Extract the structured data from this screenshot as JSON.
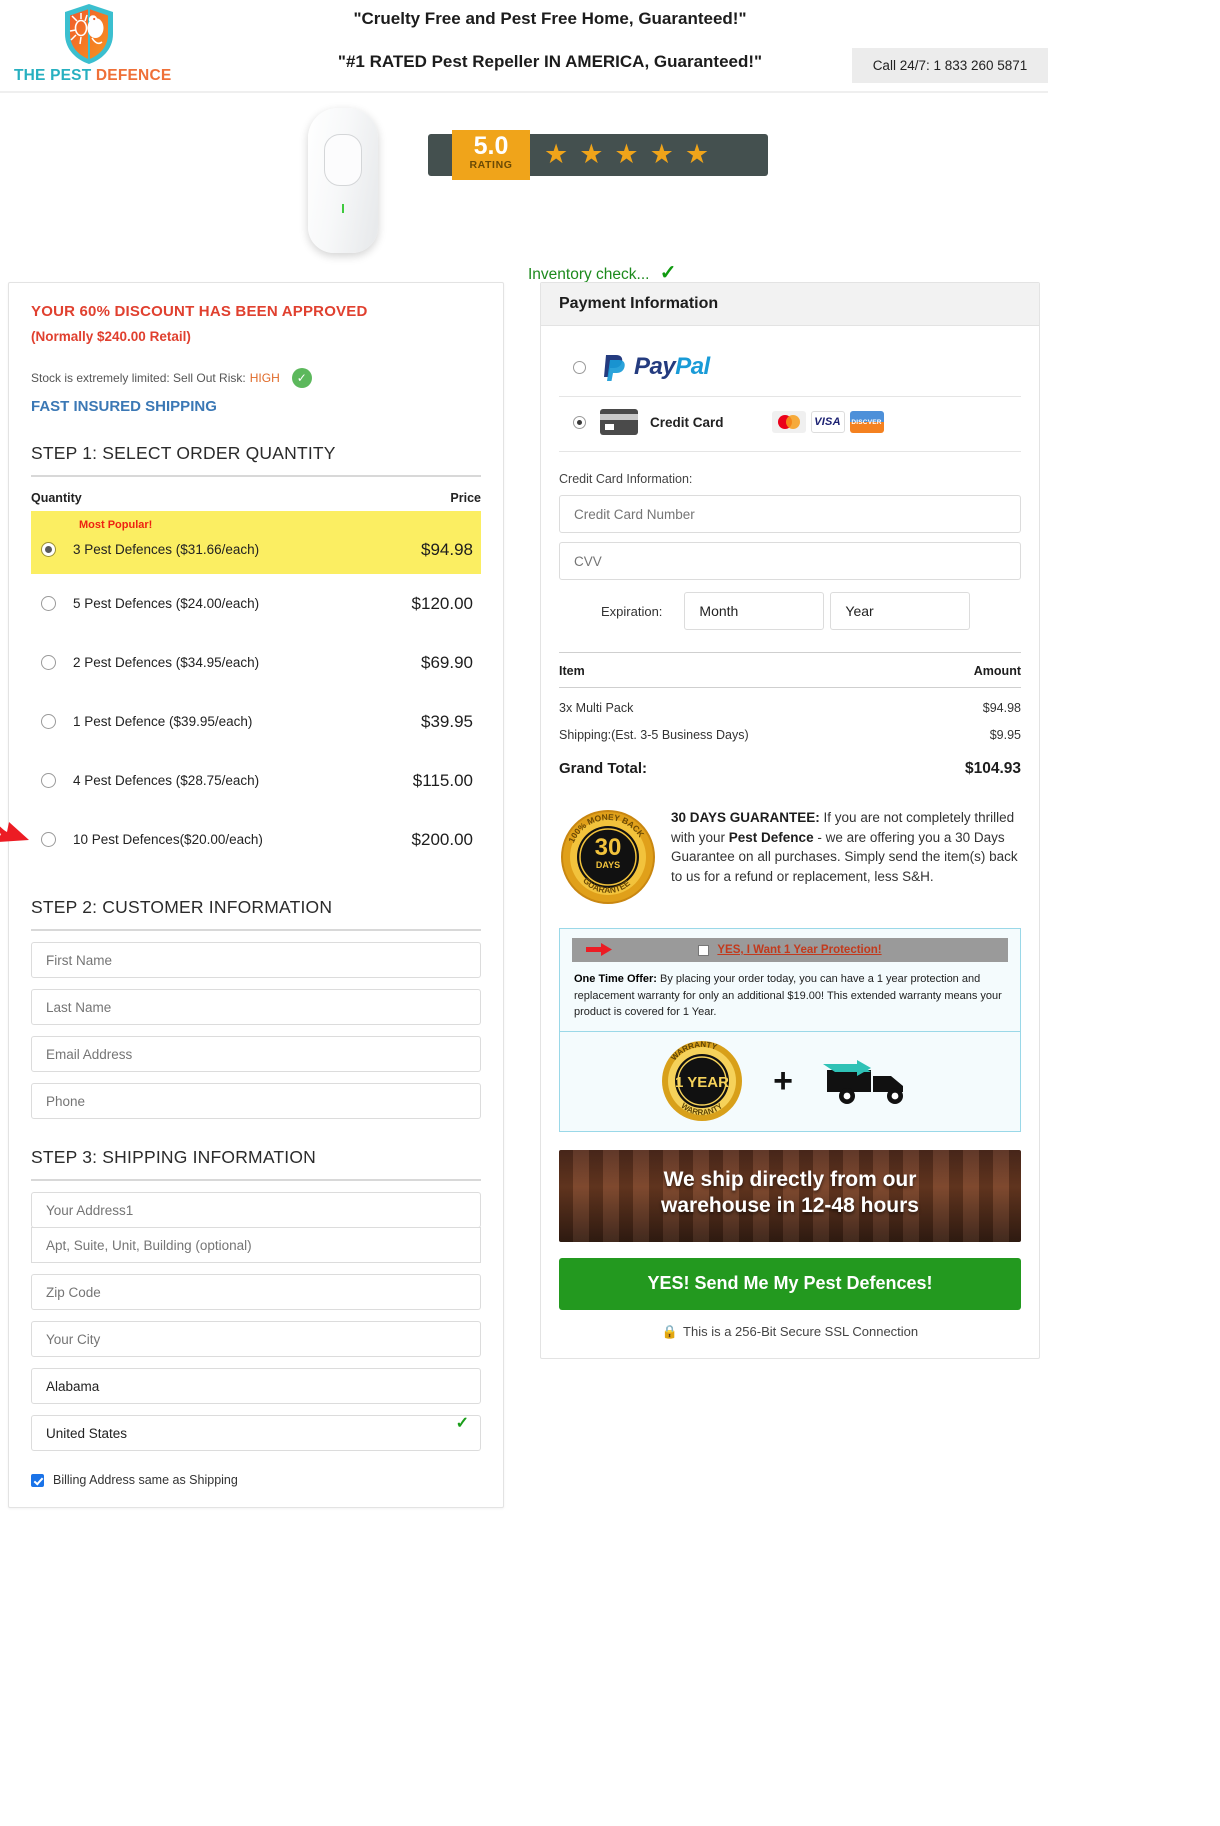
{
  "header": {
    "logo": {
      "part1": "THE PEST",
      "part2": "DEFENCE",
      "icon": "shield-bug-icon"
    },
    "headline1": "\"Cruelty Free and Pest Free Home, Guaranteed!\"",
    "headline2": "\"#1 RATED Pest Repeller IN AMERICA, Guaranteed!\"",
    "call": "Call 24/7: 1 833 260 5871"
  },
  "hero": {
    "rating_value": "5.0",
    "rating_label": "RATING",
    "stars": "★★★★★",
    "inventory_text": "Inventory check...",
    "inventory_check": "✓"
  },
  "left": {
    "discount_headline": "YOUR 60% DISCOUNT HAS BEEN APPROVED",
    "retail_note": "(Normally $240.00 Retail)",
    "stock_text": "Stock is extremely limited: Sell Out Risk:",
    "stock_risk": "HIGH",
    "stock_check": "✓",
    "fast_shipping": "FAST INSURED SHIPPING",
    "step1_title": "STEP 1: SELECT ORDER QUANTITY",
    "col_quantity": "Quantity",
    "col_price": "Price",
    "most_popular": "Most Popular!",
    "options": [
      {
        "label": "3 Pest Defences ($31.66/each)",
        "price": "$94.98",
        "selected": true,
        "popular": true
      },
      {
        "label": "5 Pest Defences ($24.00/each)",
        "price": "$120.00",
        "selected": false,
        "popular": false
      },
      {
        "label": "2 Pest Defences ($34.95/each)",
        "price": "$69.90",
        "selected": false,
        "popular": false
      },
      {
        "label": "1 Pest Defence ($39.95/each)",
        "price": "$39.95",
        "selected": false,
        "popular": false
      },
      {
        "label": "4 Pest Defences ($28.75/each)",
        "price": "$115.00",
        "selected": false,
        "popular": false
      },
      {
        "label": "10 Pest Defences($20.00/each)",
        "price": "$200.00",
        "selected": false,
        "popular": false
      }
    ],
    "step2_title": "STEP 2: CUSTOMER INFORMATION",
    "first_name_placeholder": "First Name",
    "last_name_placeholder": "Last Name",
    "email_placeholder": "Email Address",
    "phone_placeholder": "Phone",
    "step3_title": "STEP 3: SHIPPING INFORMATION",
    "address1_placeholder": "Your Address1",
    "address2_placeholder": "Apt, Suite, Unit, Building (optional)",
    "zip_placeholder": "Zip Code",
    "city_placeholder": "Your City",
    "state_value": "Alabama",
    "country_value": "United States",
    "country_check": "✓",
    "billing_same": "Billing Address same as Shipping"
  },
  "payment": {
    "title": "Payment Information",
    "paypal_label": "PayPal",
    "credit_card_label": "Credit Card",
    "card_brands": [
      "mastercard",
      "visa",
      "discover"
    ],
    "cc_info_label": "Credit Card Information:",
    "cc_number_placeholder": "Credit Card Number",
    "cvv_placeholder": "CVV",
    "expiration_label": "Expiration:",
    "month_value": "Month",
    "year_value": "Year",
    "summary": {
      "col_item": "Item",
      "col_amount": "Amount",
      "rows": [
        {
          "item": "3x Multi Pack",
          "amount": "$94.98"
        },
        {
          "item": "Shipping:(Est. 3-5 Business Days)",
          "amount": "$9.95"
        }
      ],
      "grand_total_label": "Grand Total:",
      "grand_total_amount": "$104.93"
    },
    "guarantee": {
      "seal_line1": "100% MONEY BACK",
      "seal_days": "30",
      "seal_sub": "DAYS",
      "seal_bottom": "GUARANTEE",
      "heading": "30 DAYS GUARANTEE:",
      "body": " If you are not completely thrilled with your ",
      "product": "Pest Defence",
      "body2": " - we are offering you a 30 Days Guarantee on all purchases. Simply send the item(s) back to us for a refund or replacement, less S&H."
    },
    "upsell": {
      "checkbox_label": "YES, I Want 1 Year Protection!",
      "offer_label": "One Time Offer:",
      "offer_text": " By placing your order today, you can have a 1 year protection and replacement warranty for only an additional $19.00! This extended warranty means your product is covered for 1 Year.",
      "seal_top": "WARRANTY",
      "seal_main": "1 YEAR",
      "seal_bottom": "WARRANTY",
      "plus": "+"
    },
    "ship_banner_line1": "We ship directly from our",
    "ship_banner_line2": "warehouse in 12-48 hours",
    "cta": "YES! Send Me My Pest Defences!",
    "ssl_lock": "🔒",
    "ssl_text": "This is a 256-Bit Secure SSL Connection"
  },
  "colors": {
    "brand_teal": "#27b0c0",
    "brand_orange": "#ef7038",
    "discount_red": "#e0402f",
    "highlight_yellow": "#fbee62",
    "cta_green": "#23991f",
    "link_blue": "#3b78b5",
    "rating_gold": "#f0a41a"
  }
}
